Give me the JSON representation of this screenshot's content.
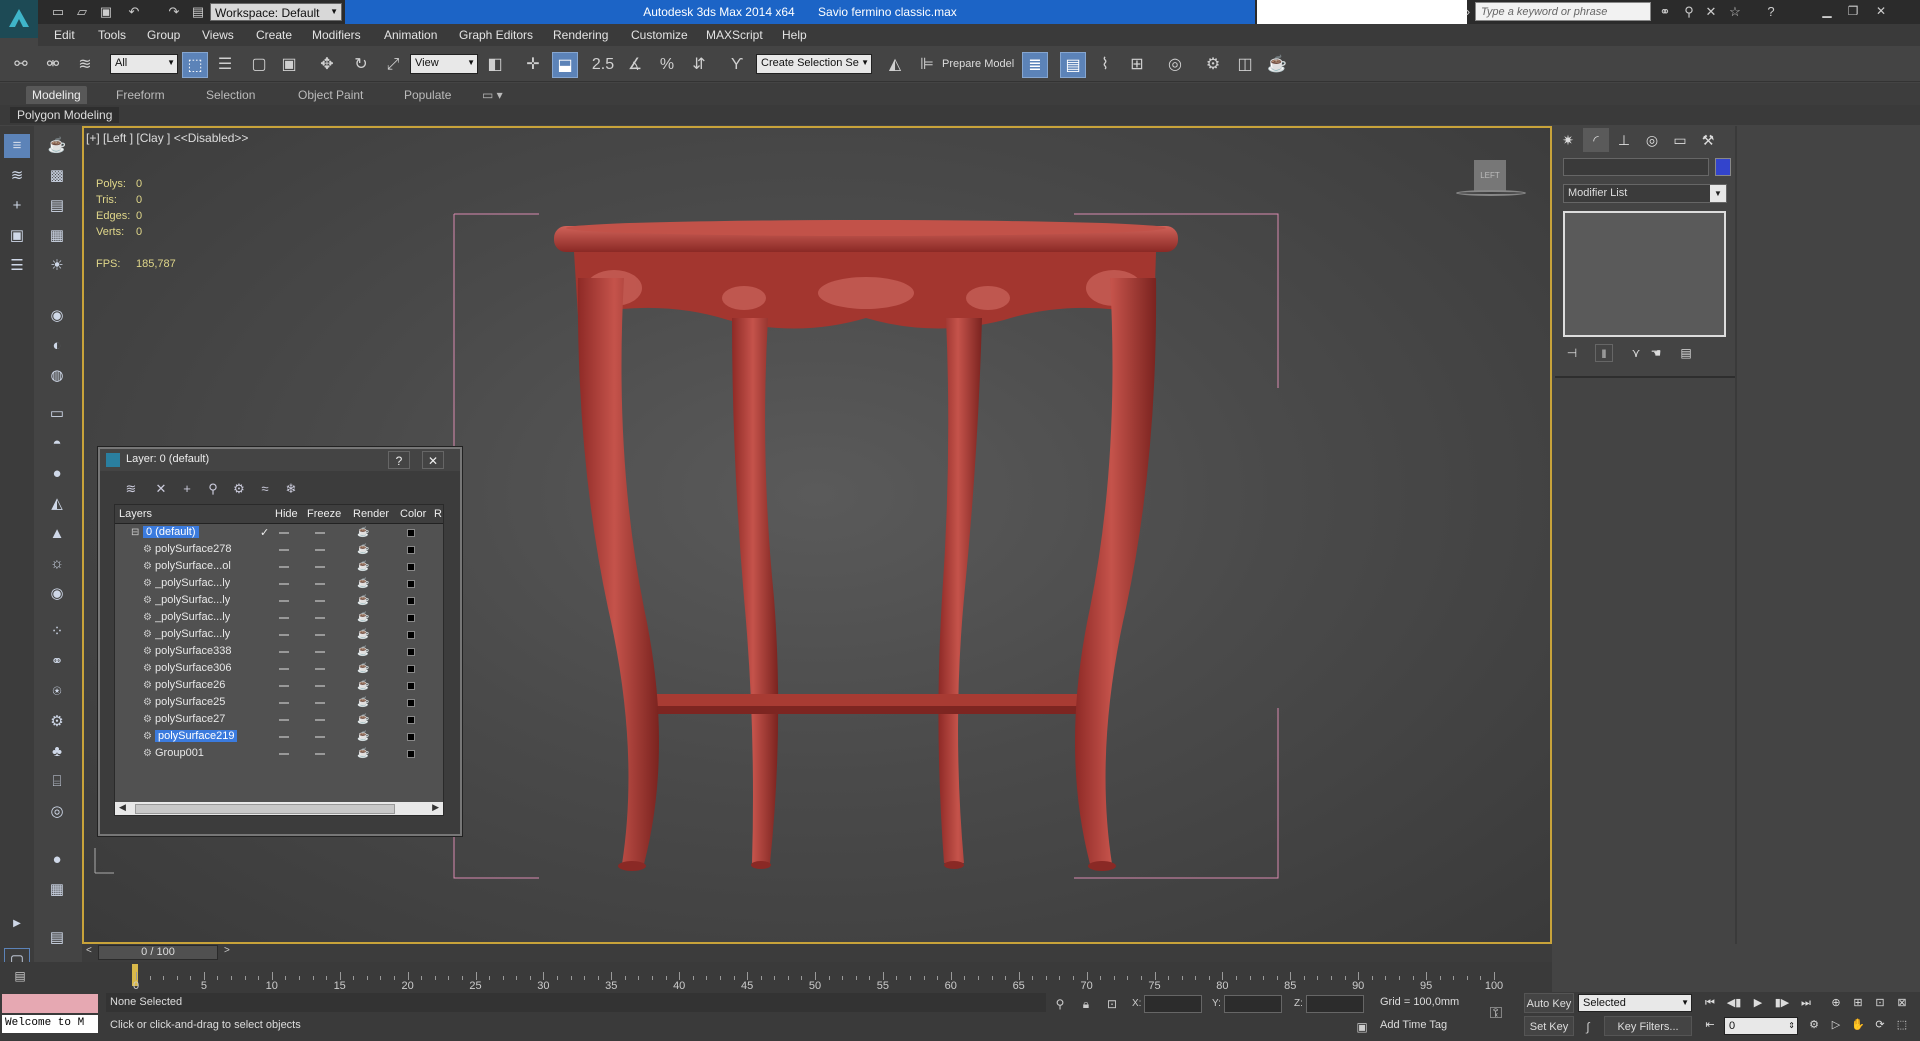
{
  "titlebar": {
    "workspace": "Workspace: Default",
    "app": "Autodesk 3ds Max  2014 x64",
    "file": "Savio fermino classic.max",
    "search_placeholder": "Type a keyword or phrase"
  },
  "menu": {
    "items": [
      "Edit",
      "Tools",
      "Group",
      "Views",
      "Create",
      "Modifiers",
      "Animation",
      "Graph Editors",
      "Rendering",
      "Customize",
      "MAXScript",
      "Help"
    ]
  },
  "toolbar": {
    "selection_filter": "All",
    "ref_coord": "View",
    "snap_angle": "2.5",
    "selection_set": "Create Selection Se",
    "prepare_model": "Prepare Model"
  },
  "ribbon": {
    "tabs": [
      "Modeling",
      "Freeform",
      "Selection",
      "Object Paint",
      "Populate"
    ],
    "panel_label": "Polygon Modeling"
  },
  "viewport": {
    "label": "[+] [Left ] [Clay ]  <<Disabled>>",
    "stats": [
      {
        "key": "Polys:",
        "value": "0"
      },
      {
        "key": "Tris:",
        "value": "0"
      },
      {
        "key": "Edges:",
        "value": "0"
      },
      {
        "key": "Verts:",
        "value": "0"
      }
    ],
    "fps_label": "FPS:",
    "fps_value": "185,787",
    "viewcube_label": "LEFT",
    "model_color": "#b8403a"
  },
  "layer_dialog": {
    "title": "Layer: 0 (default)",
    "help_label": "?",
    "close_label": "✕",
    "columns": [
      "Layers",
      "Hide",
      "Freeze",
      "Render",
      "Color",
      "R"
    ],
    "rows": [
      {
        "name": "0 (default)",
        "selected": true,
        "active_check": true
      },
      {
        "name": "polySurface278",
        "selected": false
      },
      {
        "name": "polySurface...ol",
        "selected": false
      },
      {
        "name": "_polySurfac...ly",
        "selected": false
      },
      {
        "name": "_polySurfac...ly",
        "selected": false
      },
      {
        "name": "_polySurfac...ly",
        "selected": false
      },
      {
        "name": "_polySurfac...ly",
        "selected": false
      },
      {
        "name": "polySurface338",
        "selected": false
      },
      {
        "name": "polySurface306",
        "selected": false
      },
      {
        "name": "polySurface26",
        "selected": false
      },
      {
        "name": "polySurface25",
        "selected": false
      },
      {
        "name": "polySurface27",
        "selected": false
      },
      {
        "name": "polySurface219",
        "selected": true
      },
      {
        "name": "Group001",
        "selected": false
      }
    ]
  },
  "command_panel": {
    "modifier_list": "Modifier List",
    "object_color": "#3344cc"
  },
  "timeline": {
    "frame_display": "0 / 100",
    "ticks": [
      "0",
      "5",
      "10",
      "15",
      "20",
      "25",
      "30",
      "35",
      "40",
      "45",
      "50",
      "55",
      "60",
      "65",
      "70",
      "75",
      "80",
      "85",
      "90",
      "95",
      "100"
    ]
  },
  "status": {
    "welcome": "Welcome to M",
    "selection": "None Selected",
    "prompt": "Click or click-and-drag to select objects",
    "x_label": "X:",
    "y_label": "Y:",
    "z_label": "Z:",
    "grid": "Grid = 100,0mm",
    "add_time_tag": "Add Time Tag",
    "auto_key": "Auto Key",
    "set_key": "Set Key",
    "key_mode": "Selected",
    "key_filters": "Key Filters...",
    "current_frame": "0"
  }
}
